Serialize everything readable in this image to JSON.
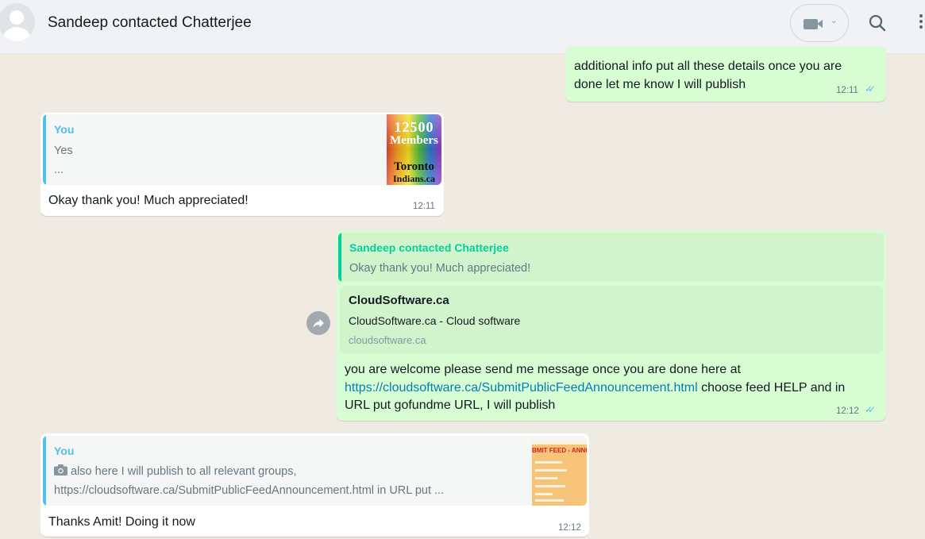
{
  "header": {
    "chat_name": "Sandeep contacted Chatterjee"
  },
  "messages": {
    "m1": {
      "text_line1": "additional info put all these details once you are",
      "text_line2": "done let me know I will publish",
      "time": "12:11"
    },
    "m2": {
      "quote_author": "You",
      "quote_line1": "Yes",
      "quote_line2": "...",
      "thumb_text1": "12500",
      "thumb_text2": "Members",
      "thumb_text3": "Toronto",
      "thumb_text4": "Indians.ca",
      "text": "Okay thank you! Much appreciated!",
      "time": "12:11"
    },
    "m3": {
      "quote_author": "Sandeep contacted Chatterjee",
      "quote_text": "Okay thank you! Much appreciated!",
      "preview_title": "CloudSoftware.ca",
      "preview_desc": "CloudSoftware.ca - Cloud software",
      "preview_domain": "cloudsoftware.ca",
      "text_line1": "you are welcome please send me message once you are done here at",
      "link": "https://cloudsoftware.ca/SubmitPublicFeedAnnouncement.html",
      "text_line2_rest": " choose feed HELP and in",
      "text_line3": "URL put gofundme URL, I will publish",
      "time": "12:12"
    },
    "m4": {
      "quote_author": "You",
      "quote_line1": "also here I will publish to all relevant groups,",
      "quote_line2": "https://cloudsoftware.ca/SubmitPublicFeedAnnouncement.html in URL put ...",
      "thumb_text": "BMIT FEED - ANNOU",
      "text": "Thanks Amit! Doing it now",
      "time": "12:12"
    }
  },
  "colors": {
    "outgoing": "#d9fdd3",
    "incoming": "#ffffff",
    "you_quote": "#53bdeb",
    "contact_quote": "#06cf9c",
    "read_ticks": "#53bdeb"
  }
}
